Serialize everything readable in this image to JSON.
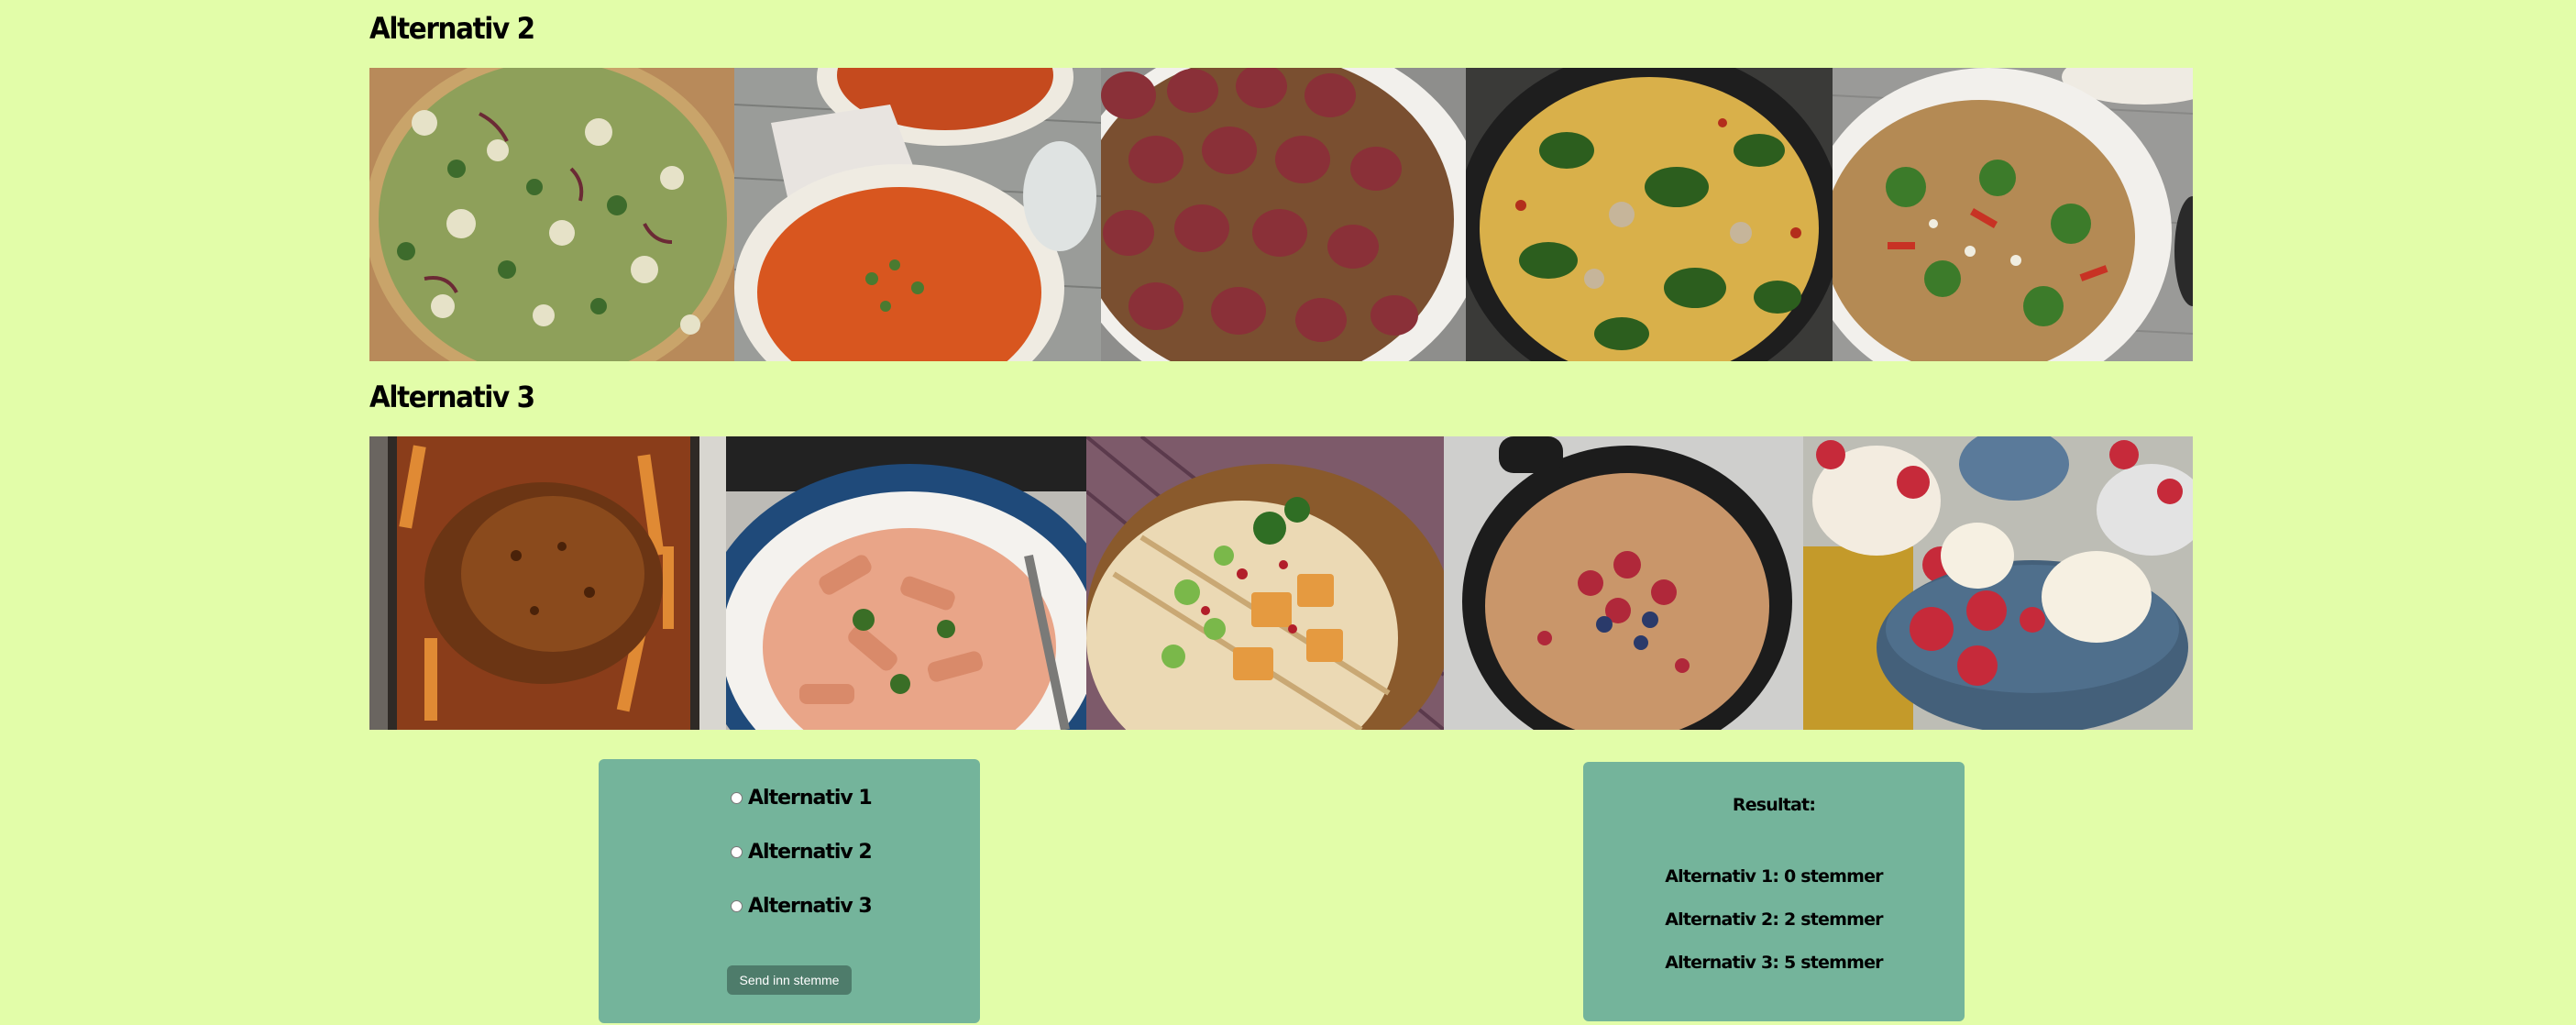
{
  "sections": [
    {
      "title": "Alternativ 2",
      "photos": [
        {
          "name": "pizza-photo",
          "icon": "pesto-chicken-pizza"
        },
        {
          "name": "soup-photo",
          "icon": "tomato-soup"
        },
        {
          "name": "pie-photo",
          "icon": "hasselback-potato-pie"
        },
        {
          "name": "pasta-spinach-photo",
          "icon": "penne-spinach-pasta"
        },
        {
          "name": "noodle-salad-photo",
          "icon": "noodle-salad-bowl"
        }
      ]
    },
    {
      "title": "Alternativ 3",
      "photos": [
        {
          "name": "roast-chicken-photo",
          "icon": "roast-chicken"
        },
        {
          "name": "penne-tomato-photo",
          "icon": "penne-tomato-plate"
        },
        {
          "name": "tortilla-photo",
          "icon": "salmon-tortilla"
        },
        {
          "name": "skillet-cake-photo",
          "icon": "berry-skillet-cake"
        },
        {
          "name": "ice-cream-photo",
          "icon": "ice-cream-strawberries"
        }
      ]
    }
  ],
  "vote": {
    "options": [
      "Alternativ 1",
      "Alternativ 2",
      "Alternativ 3"
    ],
    "submit_label": "Send inn stemme"
  },
  "results": {
    "title": "Resultat:",
    "lines": [
      "Alternativ 1: 0 stemmer",
      "Alternativ 2: 2 stemmer",
      "Alternativ 3: 5 stemmer"
    ]
  },
  "colors": {
    "background": "#e2fda9",
    "panel": "#74b49b",
    "button": "#4e7c6b"
  }
}
